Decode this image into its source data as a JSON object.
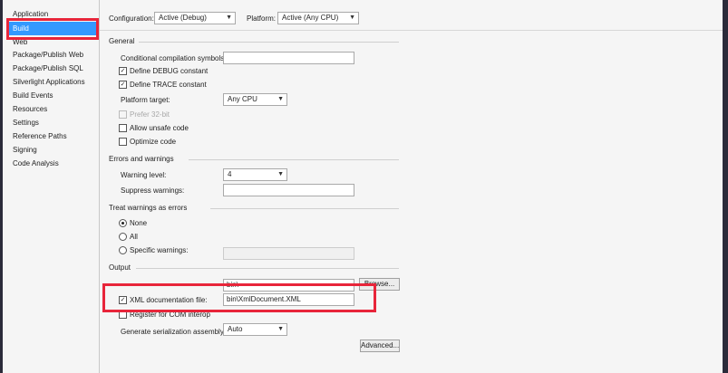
{
  "sidebar": {
    "items": [
      "Application",
      "Build",
      "Web",
      "Package/Publish Web",
      "Package/Publish SQL",
      "Silverlight Applications",
      "Build Events",
      "Resources",
      "Settings",
      "Reference Paths",
      "Signing",
      "Code Analysis"
    ]
  },
  "toolbar": {
    "configuration_label": "Configuration:",
    "configuration_value": "Active (Debug)",
    "platform_label": "Platform:",
    "platform_value": "Active (Any CPU)"
  },
  "general": {
    "header": "General",
    "conditional_symbols_label": "Conditional compilation symbols:",
    "conditional_symbols_value": "",
    "define_debug": "Define DEBUG constant",
    "define_trace": "Define TRACE constant",
    "platform_target_label": "Platform target:",
    "platform_target_value": "Any CPU",
    "prefer_32bit": "Prefer 32-bit",
    "allow_unsafe": "Allow unsafe code",
    "optimize": "Optimize code"
  },
  "errors": {
    "header": "Errors and warnings",
    "warning_level_label": "Warning level:",
    "warning_level_value": "4",
    "suppress_label": "Suppress warnings:",
    "suppress_value": ""
  },
  "treat": {
    "header": "Treat warnings as errors",
    "none": "None",
    "all": "All",
    "specific": "Specific warnings:"
  },
  "output": {
    "header": "Output",
    "output_path_value": "bin\\",
    "browse": "Browse...",
    "xml_doc_label": "XML documentation file:",
    "xml_doc_value": "bin\\XmlDocument.XML",
    "register_com": "Register for COM interop",
    "serialization_label": "Generate serialization assembly:",
    "serialization_value": "Auto",
    "advanced": "Advanced..."
  },
  "colors": {
    "accent": "#3399ff",
    "highlight": "#e8253a"
  }
}
